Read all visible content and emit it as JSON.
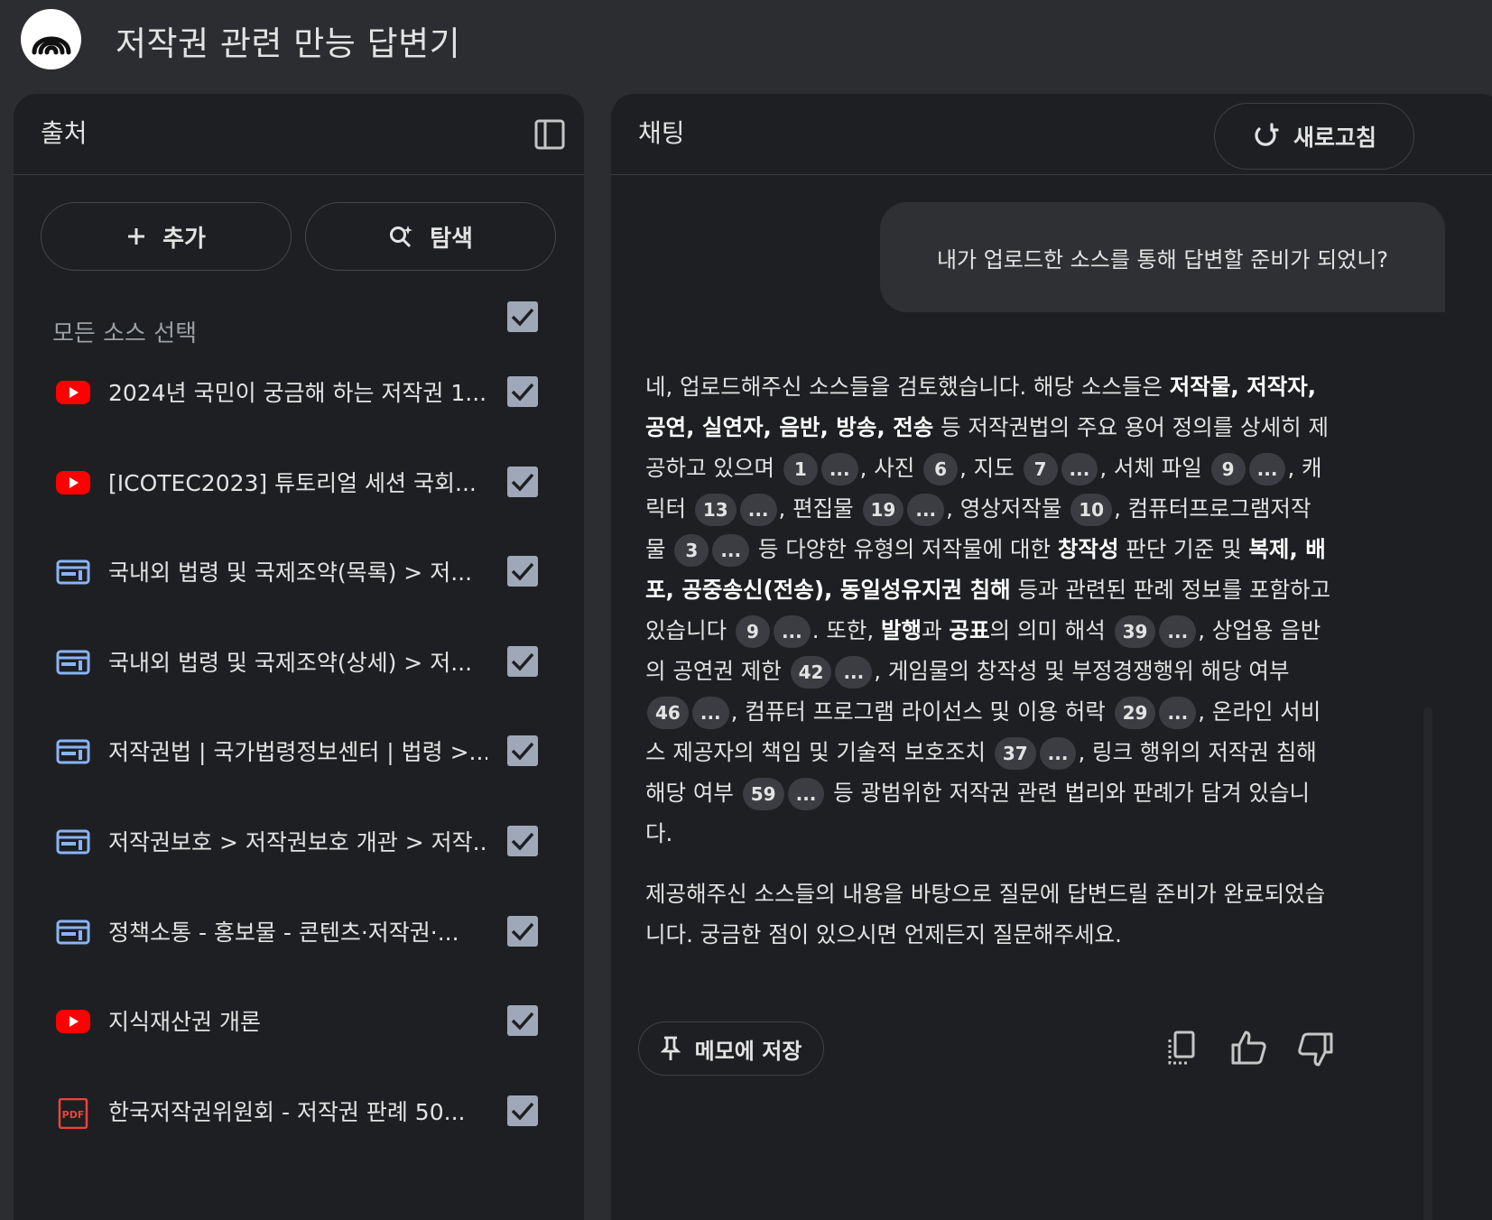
{
  "app": {
    "title": "저작권 관련 만능 답변기"
  },
  "sources_panel": {
    "title": "출처",
    "add_label": "추가",
    "search_label": "탐색",
    "select_all_label": "모든 소스 선택",
    "items": [
      {
        "type": "youtube",
        "label": "2024년 국민이 궁금해 하는 저작권 1..."
      },
      {
        "type": "youtube",
        "label": "[ICOTEC2023] 튜토리얼 세션 국회..."
      },
      {
        "type": "web",
        "label": "국내외 법령 및 국제조약(목록) > 저..."
      },
      {
        "type": "web",
        "label": "국내외 법령 및 국제조약(상세) > 저..."
      },
      {
        "type": "web",
        "label": "저작권법 | 국가법령정보센터 | 법령 >..."
      },
      {
        "type": "web",
        "label": "저작권보호 > 저작권보호 개관 > 저작..."
      },
      {
        "type": "web",
        "label": "정책소통 - 홍보물 - 콘텐츠·저작권·..."
      },
      {
        "type": "youtube",
        "label": "지식재산권 개론"
      },
      {
        "type": "pdf",
        "label": "한국저작권위원회 - 저작권 판례 50..."
      }
    ]
  },
  "chat_panel": {
    "title": "채팅",
    "refresh_label": "새로고침",
    "user_message": "내가 업로드한 소스를 통해 답변할 준비가 되었니?",
    "answer": {
      "p1": [
        {
          "t": "네, 업로드해주신 소스들을 검토했습니다. 해당 소스들은 "
        },
        {
          "b": "저작물, 저작자, 공연, 실연자, 음반, 방송, 전송"
        },
        {
          "t": " 등 저작권법의 주요 용어 정의를 상세히 제공하고 있으며 "
        },
        {
          "c": "1"
        },
        {
          "c": "..."
        },
        {
          "t": ", 사진 "
        },
        {
          "c": "6"
        },
        {
          "t": ", 지도 "
        },
        {
          "c": "7"
        },
        {
          "c": "..."
        },
        {
          "t": ", 서체 파일 "
        },
        {
          "c": "9"
        },
        {
          "c": "..."
        },
        {
          "t": ", 캐릭터 "
        },
        {
          "c": "13"
        },
        {
          "c": "..."
        },
        {
          "t": ", 편집물 "
        },
        {
          "c": "19"
        },
        {
          "c": "..."
        },
        {
          "t": ", 영상저작물 "
        },
        {
          "c": "10"
        },
        {
          "t": ", 컴퓨터프로그램저작물 "
        },
        {
          "c": "3"
        },
        {
          "c": "..."
        },
        {
          "t": " 등 다양한 유형의 저작물에 대한 "
        },
        {
          "b": "창작성"
        },
        {
          "t": " 판단 기준 및 "
        },
        {
          "b": "복제, 배포, 공중송신(전송), 동일성유지권 침해"
        },
        {
          "t": " 등과 관련된 판례 정보를 포함하고 있습니다 "
        },
        {
          "c": "9"
        },
        {
          "c": "..."
        },
        {
          "t": ". 또한, "
        },
        {
          "b": "발행"
        },
        {
          "t": "과 "
        },
        {
          "b": "공표"
        },
        {
          "t": "의 의미 해석 "
        },
        {
          "c": "39"
        },
        {
          "c": "..."
        },
        {
          "t": ", 상업용 음반의 공연권 제한 "
        },
        {
          "c": "42"
        },
        {
          "c": "..."
        },
        {
          "t": ", 게임물의 창작성 및 부정경쟁행위 해당 여부 "
        },
        {
          "c": "46"
        },
        {
          "c": "..."
        },
        {
          "t": ", 컴퓨터 프로그램 라이선스 및 이용 허락 "
        },
        {
          "c": "29"
        },
        {
          "c": "..."
        },
        {
          "t": ", 온라인 서비스 제공자의 책임 및 기술적 보호조치 "
        },
        {
          "c": "37"
        },
        {
          "c": "..."
        },
        {
          "t": ", 링크 행위의 저작권 침해 해당 여부 "
        },
        {
          "c": "59"
        },
        {
          "c": "..."
        },
        {
          "t": " 등 광범위한 저작권 관련 법리와 판례가 담겨 있습니다."
        }
      ],
      "p2": "제공해주신 소스들의 내용을 바탕으로 질문에 답변드릴 준비가 완료되었습니다. 궁금한 점이 있으시면 언제든지 질문해주세요."
    },
    "memo_label": "메모에 저장"
  },
  "colors": {
    "background": "#2c2d30",
    "panel": "#1e1f22",
    "checkbox": "#9fa8b8",
    "youtube_red": "#ff0000",
    "web_blue": "#8ab4f8",
    "pdf_red": "#e8453c",
    "citation_chip": "#3b3d42"
  }
}
